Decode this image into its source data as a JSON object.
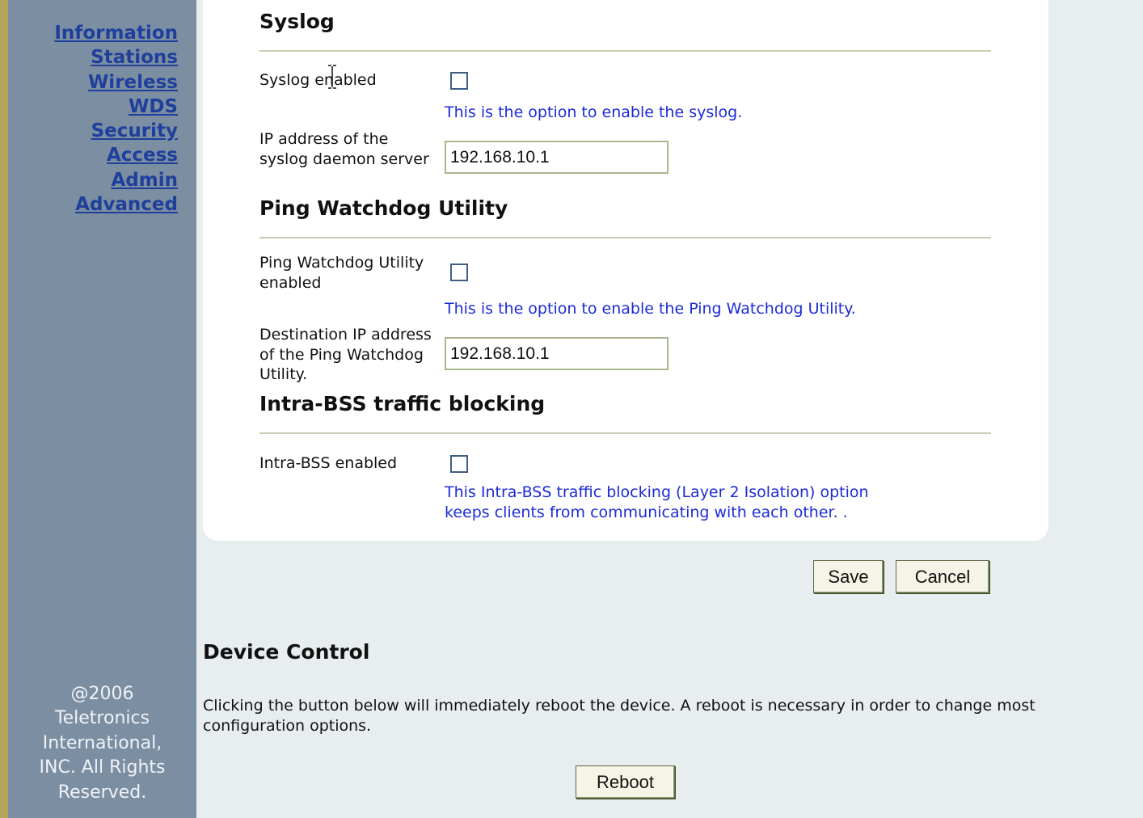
{
  "sidebar": {
    "nav": [
      {
        "label": "Information"
      },
      {
        "label": "Stations"
      },
      {
        "label": "Wireless"
      },
      {
        "label": "WDS"
      },
      {
        "label": "Security"
      },
      {
        "label": "Access"
      },
      {
        "label": "Admin"
      },
      {
        "label": "Advanced"
      }
    ],
    "copyright": [
      "@2006",
      "Teletronics",
      "International,",
      "INC. All Rights",
      "Reserved."
    ]
  },
  "syslog": {
    "title": "Syslog",
    "enabled_label": "Syslog enabled",
    "enabled_help": "This is the option to enable the syslog.",
    "ip_label": "IP address of the syslog daemon server",
    "ip_value": "192.168.10.1"
  },
  "ping_watchdog": {
    "title": "Ping Watchdog Utility",
    "enabled_label": "Ping Watchdog Utility enabled",
    "enabled_help": "This is the option to enable the Ping Watchdog Utility.",
    "dest_label": "Destination IP address of the Ping Watchdog Utility.",
    "dest_value": "192.168.10.1"
  },
  "intra_bss": {
    "title": "Intra-BSS traffic blocking",
    "enabled_label": "Intra-BSS enabled",
    "enabled_help_line1": "This Intra-BSS traffic blocking (Layer 2 Isolation) option",
    "enabled_help_line2": "keeps clients from communicating with each other. ."
  },
  "buttons": {
    "save": "Save",
    "cancel": "Cancel"
  },
  "device_control": {
    "title": "Device Control",
    "description": "Clicking the button below will immediately reboot the device. A reboot is necessary in order to change most configuration options.",
    "reboot": "Reboot"
  },
  "colors": {
    "sidebar_bg": "#7c8ea2",
    "nav_link": "#1e3f9c",
    "help_text": "#1c2bd6",
    "page_bg": "#e8edf0"
  }
}
